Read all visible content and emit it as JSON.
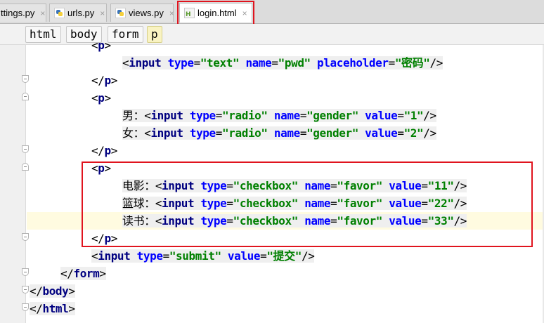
{
  "tabs": [
    {
      "label": "ttings.py",
      "icon": "python-file-icon",
      "active": false
    },
    {
      "label": "urls.py",
      "icon": "python-file-icon",
      "active": false
    },
    {
      "label": "views.py",
      "icon": "python-file-icon",
      "active": false
    },
    {
      "label": "login.html",
      "icon": "html-file-icon",
      "active": true
    }
  ],
  "tab_close_glyph": "×",
  "breadcrumb": [
    "html",
    "body",
    "form",
    "p"
  ],
  "colors": {
    "tag": "#000080",
    "attribute": "#0000ff",
    "string": "#008000",
    "annotation": "#e0141e",
    "current_line": "#fffbe0"
  },
  "code": [
    {
      "segments": [
        [
          "punct",
          "<"
        ],
        [
          "tag",
          "p"
        ],
        [
          "punct",
          ">"
        ]
      ]
    },
    {
      "segments": [
        [
          "punct",
          "<"
        ],
        [
          "tag",
          "input "
        ],
        [
          "attr",
          "type"
        ],
        [
          "punct",
          "="
        ],
        [
          "val",
          "\"text\" "
        ],
        [
          "attr",
          "name"
        ],
        [
          "punct",
          "="
        ],
        [
          "val",
          "\"pwd\" "
        ],
        [
          "attr",
          "placeholder"
        ],
        [
          "punct",
          "="
        ],
        [
          "val",
          "\"密码\""
        ],
        [
          "punct",
          "/>"
        ]
      ]
    },
    {
      "segments": [
        [
          "punct",
          "</"
        ],
        [
          "tag",
          "p"
        ],
        [
          "punct",
          ">"
        ]
      ]
    },
    {
      "segments": [
        [
          "punct",
          "<"
        ],
        [
          "tag",
          "p"
        ],
        [
          "punct",
          ">"
        ]
      ]
    },
    {
      "segments": [
        [
          "text",
          "男："
        ],
        [
          "punct",
          "<"
        ],
        [
          "tag",
          "input "
        ],
        [
          "attr",
          "type"
        ],
        [
          "punct",
          "="
        ],
        [
          "val",
          "\"radio\" "
        ],
        [
          "attr",
          "name"
        ],
        [
          "punct",
          "="
        ],
        [
          "val",
          "\"gender\" "
        ],
        [
          "attr",
          "value"
        ],
        [
          "punct",
          "="
        ],
        [
          "val",
          "\"1\""
        ],
        [
          "punct",
          "/>"
        ]
      ]
    },
    {
      "segments": [
        [
          "text",
          "女："
        ],
        [
          "punct",
          "<"
        ],
        [
          "tag",
          "input "
        ],
        [
          "attr",
          "type"
        ],
        [
          "punct",
          "="
        ],
        [
          "val",
          "\"radio\" "
        ],
        [
          "attr",
          "name"
        ],
        [
          "punct",
          "="
        ],
        [
          "val",
          "\"gender\" "
        ],
        [
          "attr",
          "value"
        ],
        [
          "punct",
          "="
        ],
        [
          "val",
          "\"2\""
        ],
        [
          "punct",
          "/>"
        ]
      ]
    },
    {
      "segments": [
        [
          "punct",
          "</"
        ],
        [
          "tag",
          "p"
        ],
        [
          "punct",
          ">"
        ]
      ]
    },
    {
      "segments": [
        [
          "punct",
          "<"
        ],
        [
          "tag",
          "p"
        ],
        [
          "punct",
          ">"
        ]
      ]
    },
    {
      "segments": [
        [
          "text",
          "电影："
        ],
        [
          "punct",
          "<"
        ],
        [
          "tag",
          "input "
        ],
        [
          "attr",
          "type"
        ],
        [
          "punct",
          "="
        ],
        [
          "val",
          "\"checkbox\" "
        ],
        [
          "attr",
          "name"
        ],
        [
          "punct",
          "="
        ],
        [
          "val",
          "\"favor\" "
        ],
        [
          "attr",
          "value"
        ],
        [
          "punct",
          "="
        ],
        [
          "val",
          "\"11\""
        ],
        [
          "punct",
          "/>"
        ]
      ]
    },
    {
      "segments": [
        [
          "text",
          "篮球："
        ],
        [
          "punct",
          "<"
        ],
        [
          "tag",
          "input "
        ],
        [
          "attr",
          "type"
        ],
        [
          "punct",
          "="
        ],
        [
          "val",
          "\"checkbox\" "
        ],
        [
          "attr",
          "name"
        ],
        [
          "punct",
          "="
        ],
        [
          "val",
          "\"favor\" "
        ],
        [
          "attr",
          "value"
        ],
        [
          "punct",
          "="
        ],
        [
          "val",
          "\"22\""
        ],
        [
          "punct",
          "/>"
        ]
      ]
    },
    {
      "segments": [
        [
          "text",
          "读书："
        ],
        [
          "punct",
          "<"
        ],
        [
          "tag",
          "input "
        ],
        [
          "attr",
          "type"
        ],
        [
          "punct",
          "="
        ],
        [
          "val",
          "\"checkbox\" "
        ],
        [
          "attr",
          "name"
        ],
        [
          "punct",
          "="
        ],
        [
          "val",
          "\"favor\" "
        ],
        [
          "attr",
          "value"
        ],
        [
          "punct",
          "="
        ],
        [
          "val",
          "\"33\""
        ],
        [
          "punct",
          "/>"
        ]
      ]
    },
    {
      "segments": [
        [
          "punct",
          "</"
        ],
        [
          "tag",
          "p"
        ],
        [
          "punct",
          ">"
        ]
      ]
    },
    {
      "segments": [
        [
          "punct",
          "<"
        ],
        [
          "tag",
          "input "
        ],
        [
          "attr",
          "type"
        ],
        [
          "punct",
          "="
        ],
        [
          "val",
          "\"submit\" "
        ],
        [
          "attr",
          "value"
        ],
        [
          "punct",
          "="
        ],
        [
          "val",
          "\"提交\""
        ],
        [
          "punct",
          "/>"
        ]
      ]
    },
    {
      "segments": [
        [
          "punct",
          "</"
        ],
        [
          "tag",
          "form"
        ],
        [
          "punct",
          ">"
        ]
      ]
    },
    {
      "segments": [
        [
          "punct",
          "</"
        ],
        [
          "tag",
          "body"
        ],
        [
          "punct",
          ">"
        ]
      ]
    },
    {
      "segments": [
        [
          "punct",
          "</"
        ],
        [
          "tag",
          "html"
        ],
        [
          "punct",
          ">"
        ]
      ]
    }
  ]
}
